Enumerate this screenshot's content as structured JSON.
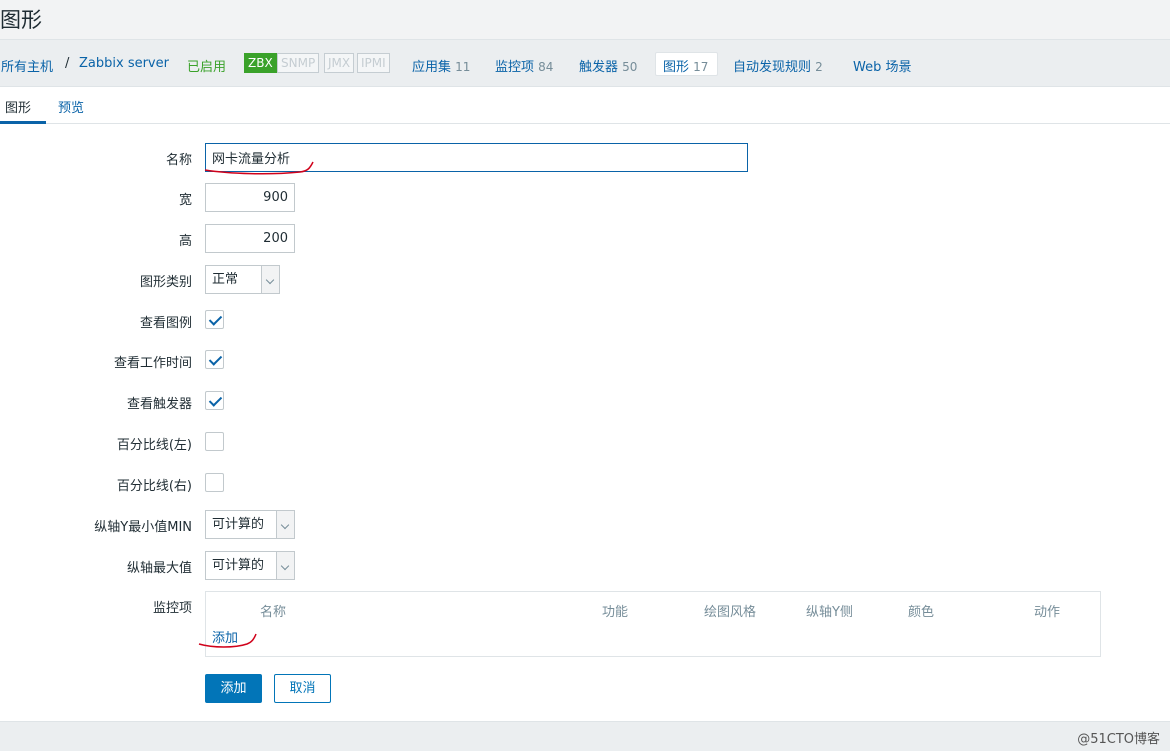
{
  "page": {
    "title": "图形"
  },
  "host_nav": {
    "all_hosts": "所有主机",
    "separator": "/",
    "host_name": "Zabbix server",
    "status": "已启用",
    "availability": [
      "ZBX",
      "SNMP",
      "JMX",
      "IPMI"
    ],
    "availability_active": "ZBX",
    "tabs": [
      {
        "label": "应用集",
        "count": "11"
      },
      {
        "label": "监控项",
        "count": "84"
      },
      {
        "label": "触发器",
        "count": "50"
      },
      {
        "label": "图形",
        "count": "17"
      },
      {
        "label": "自动发现规则",
        "count": "2"
      },
      {
        "label": "Web 场景",
        "count": ""
      }
    ],
    "current_tab": "图形"
  },
  "subtabs": {
    "graph": "图形",
    "preview": "预览",
    "active": "图形"
  },
  "form": {
    "name_label": "名称",
    "name_value": "网卡流量分析",
    "width_label": "宽",
    "width_value": "900",
    "height_label": "高",
    "height_value": "200",
    "graph_type_label": "图形类别",
    "graph_type_value": "正常",
    "show_legend_label": "查看图例",
    "show_legend": true,
    "show_working_time_label": "查看工作时间",
    "show_working_time": true,
    "show_triggers_label": "查看触发器",
    "show_triggers": true,
    "percentile_left_label": "百分比线(左)",
    "percentile_left": false,
    "percentile_right_label": "百分比线(右)",
    "percentile_right": false,
    "ymin_label": "纵轴Y最小值MIN",
    "ymin_value": "可计算的",
    "ymax_label": "纵轴最大值",
    "ymax_value": "可计算的",
    "items_label": "监控项",
    "items_columns": [
      "名称",
      "功能",
      "绘图风格",
      "纵轴Y侧",
      "颜色",
      "动作"
    ],
    "items_add_link": "添加"
  },
  "buttons": {
    "add": "添加",
    "cancel": "取消"
  },
  "watermark": "@51CTO博客",
  "colors": {
    "link": "#0a63a8",
    "primary": "#0275b8",
    "enabled": "#3aa22a",
    "annotation": "#d0021b"
  }
}
